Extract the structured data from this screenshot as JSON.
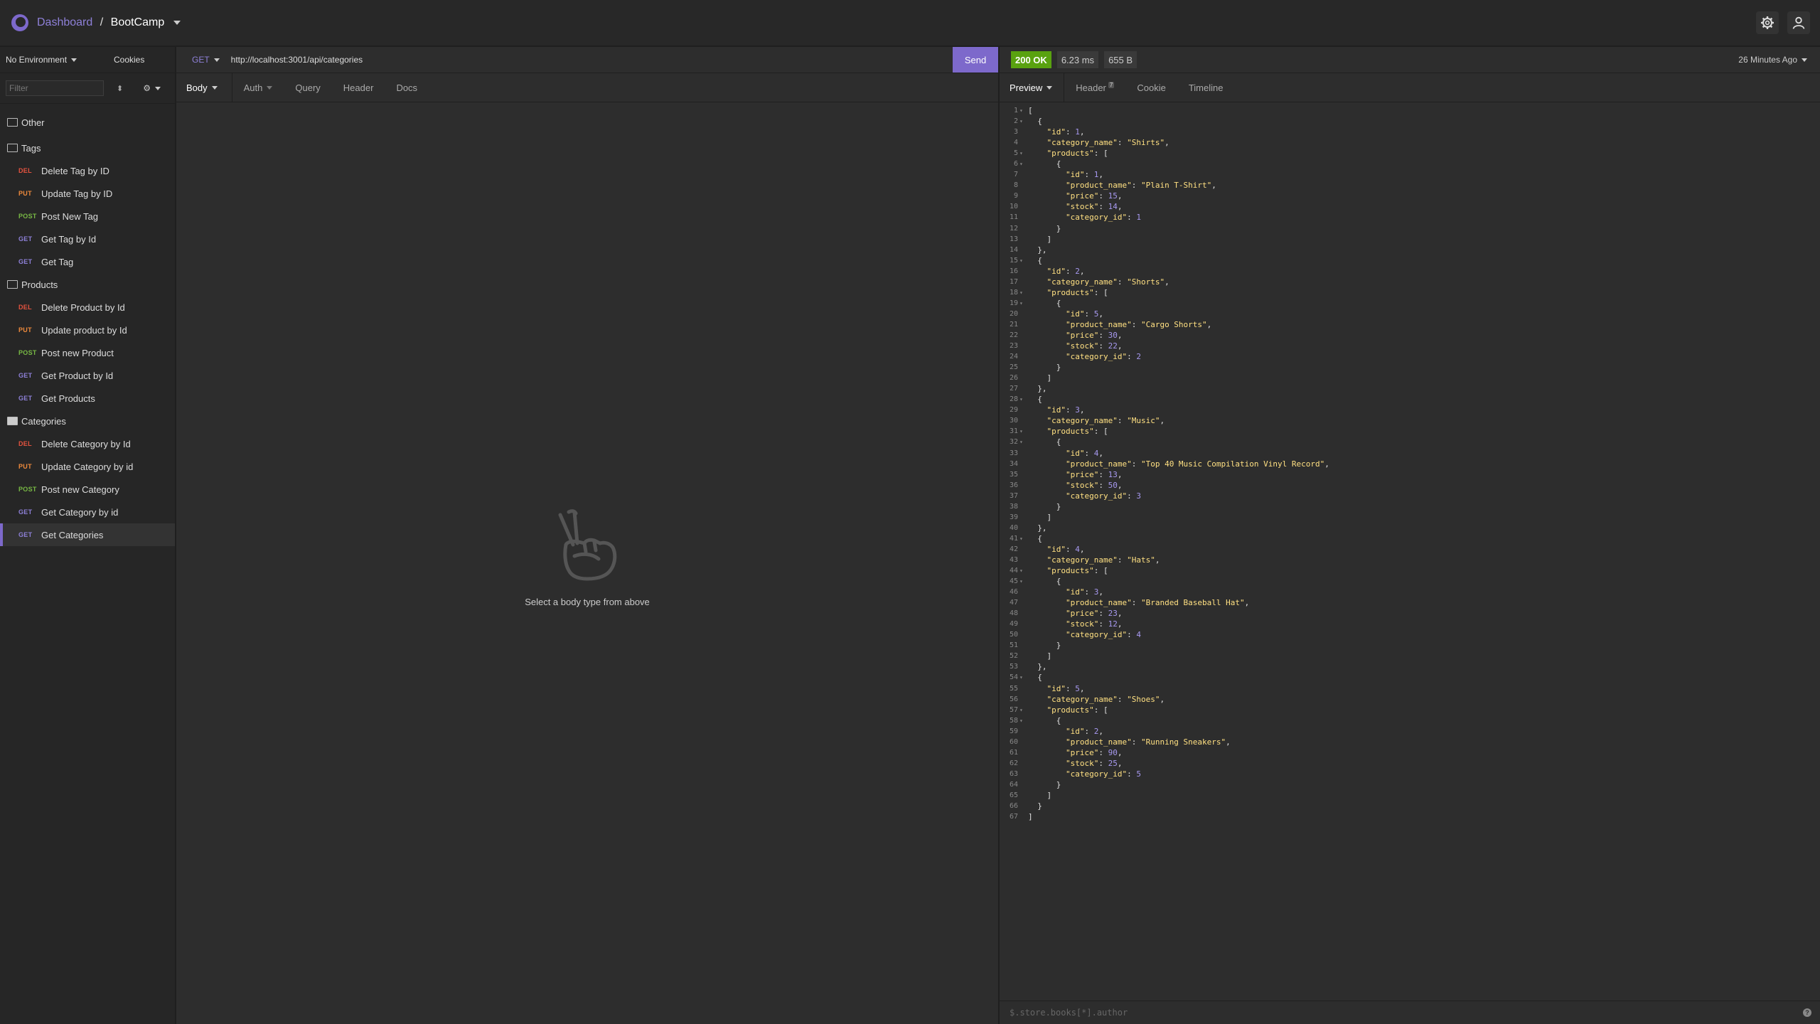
{
  "header": {
    "dashboard_label": "Dashboard",
    "separator": "/",
    "project_label": "BootCamp"
  },
  "sidebar": {
    "environment": "No Environment",
    "cookies": "Cookies",
    "filter_placeholder": "Filter",
    "groups": [
      {
        "name": "Other",
        "items": []
      },
      {
        "name": "Tags",
        "items": [
          {
            "method": "DEL",
            "label": "Delete Tag by ID"
          },
          {
            "method": "PUT",
            "label": "Update Tag by ID"
          },
          {
            "method": "POST",
            "label": "Post New Tag"
          },
          {
            "method": "GET",
            "label": "Get Tag by Id"
          },
          {
            "method": "GET",
            "label": "Get Tag"
          }
        ]
      },
      {
        "name": "Products",
        "items": [
          {
            "method": "DEL",
            "label": "Delete Product by Id"
          },
          {
            "method": "PUT",
            "label": "Update product by Id"
          },
          {
            "method": "POST",
            "label": "Post new Product"
          },
          {
            "method": "GET",
            "label": "Get Product by Id"
          },
          {
            "method": "GET",
            "label": "Get Products"
          }
        ]
      },
      {
        "name": "Categories",
        "items": [
          {
            "method": "DEL",
            "label": "Delete Category by Id"
          },
          {
            "method": "PUT",
            "label": "Update Category by id"
          },
          {
            "method": "POST",
            "label": "Post new Category"
          },
          {
            "method": "GET",
            "label": "Get Category by id"
          },
          {
            "method": "GET",
            "label": "Get Categories",
            "selected": true
          }
        ]
      }
    ]
  },
  "request": {
    "method": "GET",
    "url": "http://localhost:3001/api/categories",
    "send_label": "Send",
    "tabs": [
      "Body",
      "Auth",
      "Query",
      "Header",
      "Docs"
    ],
    "empty_message": "Select a body type from above"
  },
  "response": {
    "status": "200 OK",
    "time": "6.23 ms",
    "size": "655 B",
    "ago": "26 Minutes Ago",
    "tabs": [
      "Preview",
      "Header",
      "Cookie",
      "Timeline"
    ],
    "header_count": "7",
    "filter_placeholder": "$.store.books[*].author",
    "help_label": "?",
    "categories": [
      {
        "id": 1,
        "category_name": "Shirts",
        "products": [
          {
            "id": 1,
            "product_name": "Plain T-Shirt",
            "price": 15,
            "stock": 14,
            "category_id": 1
          }
        ]
      },
      {
        "id": 2,
        "category_name": "Shorts",
        "products": [
          {
            "id": 5,
            "product_name": "Cargo Shorts",
            "price": 30,
            "stock": 22,
            "category_id": 2
          }
        ]
      },
      {
        "id": 3,
        "category_name": "Music",
        "products": [
          {
            "id": 4,
            "product_name": "Top 40 Music Compilation Vinyl Record",
            "price": 13,
            "stock": 50,
            "category_id": 3
          }
        ]
      },
      {
        "id": 4,
        "category_name": "Hats",
        "products": [
          {
            "id": 3,
            "product_name": "Branded Baseball Hat",
            "price": 23,
            "stock": 12,
            "category_id": 4
          }
        ]
      },
      {
        "id": 5,
        "category_name": "Shoes",
        "products": [
          {
            "id": 2,
            "product_name": "Running Sneakers",
            "price": 90,
            "stock": 25,
            "category_id": 5
          }
        ]
      }
    ]
  },
  "colors": {
    "accent": "#7d69cb",
    "status_ok": "#59a210",
    "del": "#e5533f",
    "put": "#ee8a3c",
    "post": "#78b944",
    "get": "#8e80d8"
  }
}
